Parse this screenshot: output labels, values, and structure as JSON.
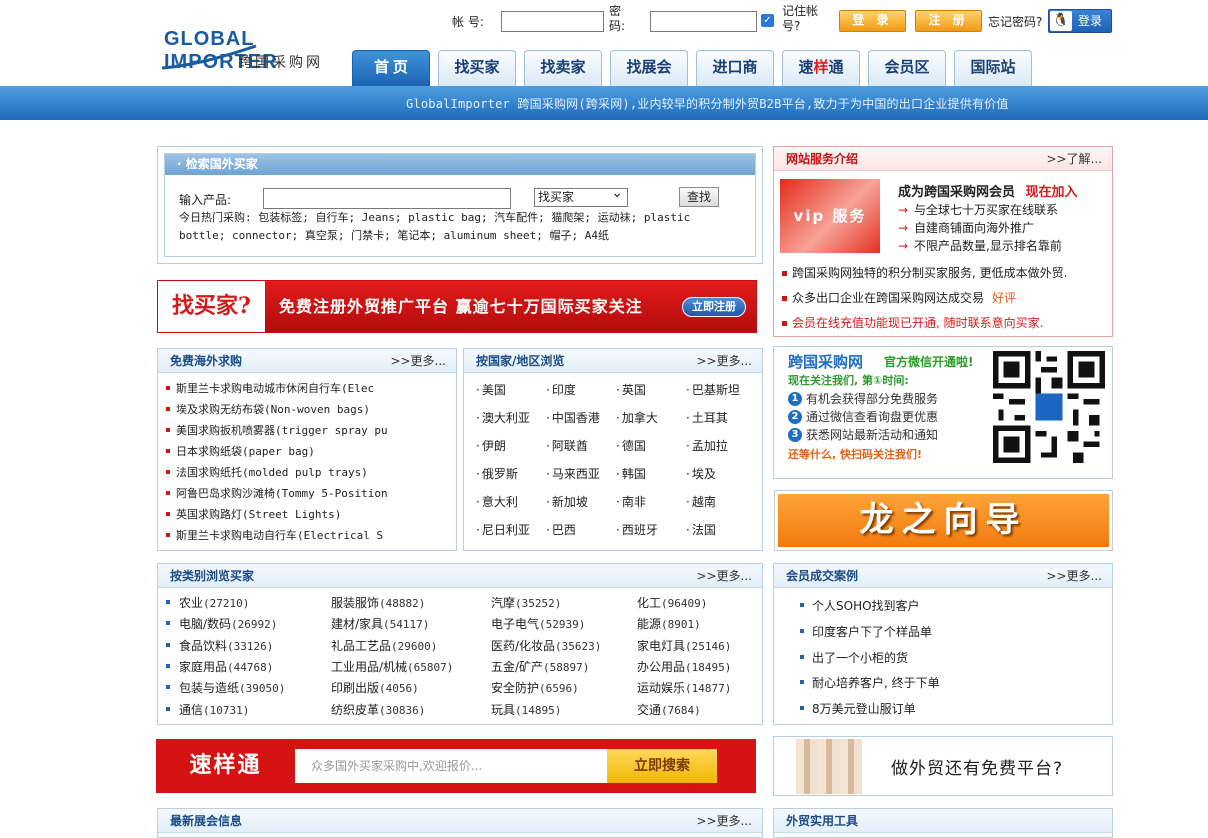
{
  "logo": {
    "en": "GLOBAL IMPORTER",
    "cn": "跨国采购网"
  },
  "login": {
    "account_label": "帐 号:",
    "password_label": "密码:",
    "remember_label": "记住帐号?",
    "login_btn": "登 录",
    "register_btn": "注 册",
    "forgot": "忘记密码?",
    "qq_login": "登录"
  },
  "nav": [
    {
      "label": "首 页",
      "active": true
    },
    {
      "label": "找买家"
    },
    {
      "label": "找卖家"
    },
    {
      "label": "找展会"
    },
    {
      "label": "进口商"
    },
    {
      "label_a": "速",
      "label_b": "样",
      "label_c": "通"
    },
    {
      "label": "会员区"
    },
    {
      "label": "国际站"
    }
  ],
  "marquee": "GlobalImporter 跨国采购网(跨采网),业内较早的积分制外贸B2B平台,致力于为中国的出口企业提供有价值",
  "search": {
    "title": "· 检索国外买家",
    "product_label": "输入产品:",
    "select_value": "找买家",
    "find_btn": "查找",
    "hot": "今日热门采购: 包装标签; 自行车; Jeans; plastic bag; 汽车配件; 猫爬架; 运动袜; plastic bottle; connector; 真空泵; 门禁卡; 笔记本; aluminum sheet; 帽子; A4纸"
  },
  "banner": {
    "left": "找买家?",
    "right": "免费注册外贸推广平台 赢逾七十万国际买家关注",
    "register": "立即注册"
  },
  "free_buy": {
    "title": "免费海外求购",
    "more": ">>更多...",
    "items": [
      "斯里兰卡求购电动城市休闲自行车(Elec",
      "埃及求购无纺布袋(Non-woven bags)",
      "美国求购扳机喷雾器(trigger spray pu",
      "日本求购纸袋(paper bag)",
      "法国求购纸托(molded pulp trays)",
      "阿鲁巴岛求购沙滩椅(Tommy 5-Position",
      "英国求购路灯(Street Lights)",
      "斯里兰卡求购电动自行车(Electrical S"
    ]
  },
  "countries": {
    "title": "按国家/地区浏览",
    "more": ">>更多...",
    "items": [
      "美国",
      "印度",
      "英国",
      "巴基斯坦",
      "澳大利亚",
      "中国香港",
      "加拿大",
      "土耳其",
      "伊朗",
      "阿联酋",
      "德国",
      "孟加拉",
      "俄罗斯",
      "马来西亚",
      "韩国",
      "埃及",
      "意大利",
      "新加坡",
      "南非",
      "越南",
      "尼日利亚",
      "巴西",
      "西班牙",
      "法国"
    ]
  },
  "categories": {
    "title": "按类别浏览买家",
    "more": ">>更多...",
    "items": [
      [
        "农业",
        "(27210)"
      ],
      [
        "服装服饰",
        "(48882)"
      ],
      [
        "汽摩",
        "(35252)"
      ],
      [
        "化工",
        "(96409)"
      ],
      [
        "电脑/数码",
        "(26992)"
      ],
      [
        "建材/家具",
        "(54117)"
      ],
      [
        "电子电气",
        "(52939)"
      ],
      [
        "能源",
        "(8901)"
      ],
      [
        "食品饮料",
        "(33126)"
      ],
      [
        "礼品工艺品",
        "(29600)"
      ],
      [
        "医药/化妆品",
        "(35623)"
      ],
      [
        "家电灯具",
        "(25146)"
      ],
      [
        "家庭用品",
        "(44768)"
      ],
      [
        "工业用品/机械",
        "(65807)"
      ],
      [
        "五金/矿产",
        "(58897)"
      ],
      [
        "办公用品",
        "(18495)"
      ],
      [
        "包装与造纸",
        "(39050)"
      ],
      [
        "印刷出版",
        "(4056)"
      ],
      [
        "安全防护",
        "(6596)"
      ],
      [
        "运动娱乐",
        "(14877)"
      ],
      [
        "通信",
        "(10731)"
      ],
      [
        "纺织皮革",
        "(30836)"
      ],
      [
        "玩具",
        "(14895)"
      ],
      [
        "交通",
        "(7684)"
      ]
    ]
  },
  "quick": {
    "title": "速样通",
    "placeholder": "众多国外买家采购中,欢迎报价...",
    "btn": "立即搜索"
  },
  "expo": {
    "title": "最新展会信息",
    "more": ">>更多..."
  },
  "service": {
    "title": "网站服务介绍",
    "more": ">>了解...",
    "vip": "vip 服务",
    "headline": "成为跨国采购网会员",
    "join": "现在加入",
    "points": [
      "与全球七十万买家在线联系",
      "自建商铺面向海外推广",
      "不限产品数量,显示排名靠前"
    ],
    "notes": [
      {
        "text": "跨国采购网独特的积分制买家服务, 更低成本做外贸.",
        "red": false
      },
      {
        "text": "众多出口企业在跨国采购网达成交易",
        "tail": "好评",
        "red": false
      },
      {
        "text": "会员在线充值功能现已开通, 随时联系意向买家.",
        "red": true
      }
    ]
  },
  "wechat": {
    "brand": "跨国采购网",
    "tag": "官方微信开通啦!",
    "follow": "现在关注我们, 第①时间:",
    "items": [
      "有机会获得部分免费服务",
      "通过微信查看询盘更优惠",
      "获悉网站最新活动和通知"
    ],
    "footer": "还等什么, 快扫码关注我们!",
    "qr_label": "跨国\n采购网"
  },
  "dragon": "龙之向导",
  "cases": {
    "title": "会员成交案例",
    "more": ">>更多...",
    "items": [
      "个人SOHO找到客户",
      "印度客户下了个样品单",
      "出了一个小柜的货",
      "耐心培养客户, 终于下单",
      "8万美元登山服订单"
    ]
  },
  "ad2": "做外贸还有免费平台?",
  "tools": {
    "title": "外贸实用工具"
  },
  "colors": {
    "nav_active": "#1a62b1",
    "band": "#2b76c2",
    "red": "#d51313",
    "orange": "#f08a1a"
  }
}
